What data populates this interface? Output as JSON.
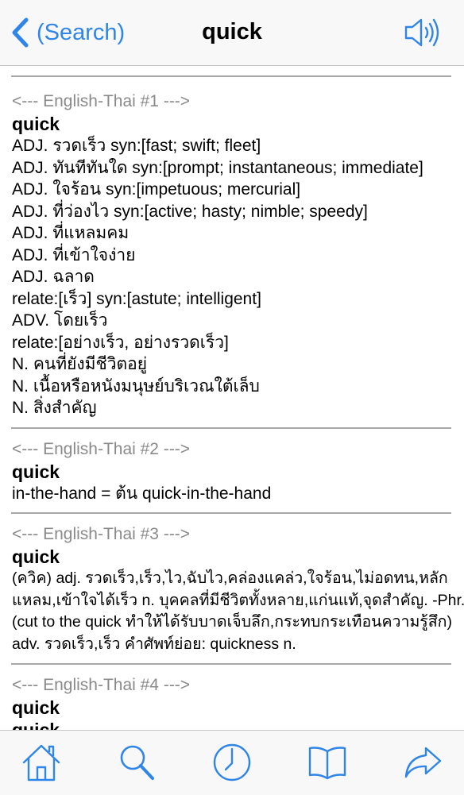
{
  "nav": {
    "back_label": "(Search)",
    "title": "quick",
    "speaker_icon": "speaker-icon"
  },
  "entries": [
    {
      "header": "<--- English-Thai #1 --->",
      "head": "quick",
      "lines": [
        "ADJ. รวดเร็ว syn:[fast; swift; fleet]",
        "ADJ. ทันทีทันใด syn:[prompt; instantaneous; immediate]",
        "ADJ. ใจร้อน syn:[impetuous; mercurial]",
        "ADJ. ที่ว่องไว syn:[active; hasty; nimble; speedy]",
        "ADJ. ที่แหลมคม",
        "ADJ. ที่เข้าใจง่าย",
        "ADJ. ฉลาด",
        "relate:[เร็ว] syn:[astute; intelligent]",
        "ADV. โดยเร็ว",
        "relate:[อย่างเร็ว, อย่างรวดเร็ว]",
        "N. คนที่ยังมีชีวิตอยู่",
        "N. เนื้อหรือหนังมนุษย์บริเวณใต้เล็บ",
        "N. สิ่งสำคัญ"
      ]
    },
    {
      "header": "<--- English-Thai #2 --->",
      "head": "quick",
      "lines": [
        "in-the-hand = ต้น quick-in-the-hand"
      ]
    },
    {
      "header": "<--- English-Thai #3 --->",
      "head": "quick",
      "lines": [
        "(ควิค) adj. รวดเร็ว,เร็ว,ไว,ฉับไว,คล่องแคล่ว,ใจร้อน,ไม่อดทน,หลัก",
        "แหลม,เข้าใจได้เร็ว n. บุคคลที่มีชีวิตทั้งหลาย,แก่นแท้,จุดสำคัญ. -Phr.",
        "(cut to the quick ทำให้ได้รับบาดเจ็บลึก,กระทบกระเทือนความรู้สึก)",
        "adv. รวดเร็ว,เร็ว คำศัพท์ย่อย: quickness n."
      ]
    },
    {
      "header": "<--- English-Thai #4 --->",
      "head": "quick",
      "lines": [
        "quick"
      ]
    }
  ],
  "tabs": [
    {
      "icon": "home-icon"
    },
    {
      "icon": "search-icon"
    },
    {
      "icon": "clock-icon"
    },
    {
      "icon": "book-icon"
    },
    {
      "icon": "share-icon"
    }
  ],
  "colors": {
    "accent": "#2f86e8",
    "header_gray": "#8a8a8a",
    "divider": "#a8a8a8",
    "bar_bg": "#f8f8f8"
  }
}
